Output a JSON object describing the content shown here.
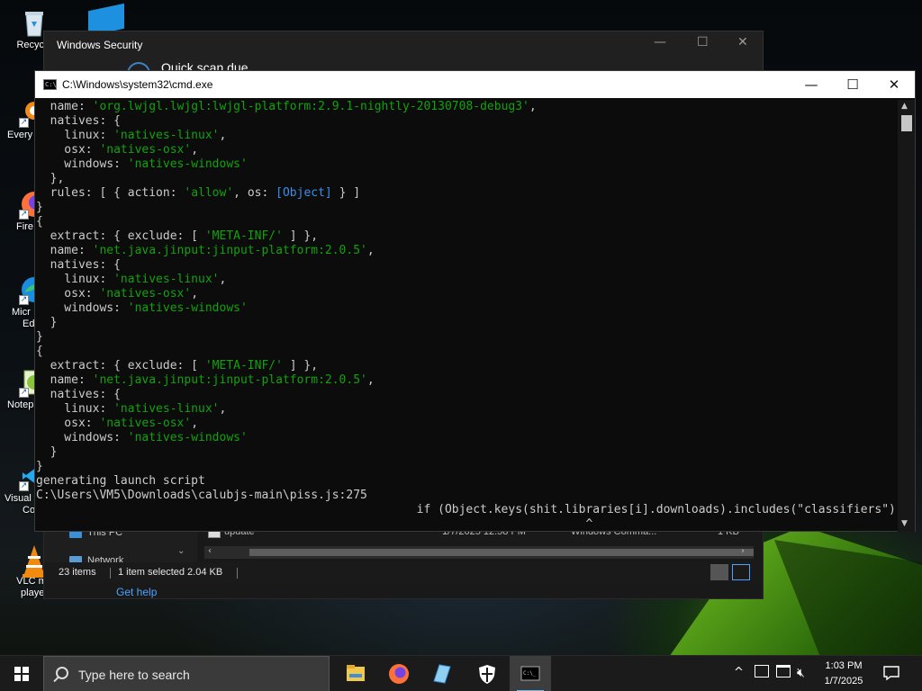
{
  "desktop": {
    "icons": [
      {
        "label": "Recycle",
        "icon": "recycle-bin-icon"
      },
      {
        "label": "Every",
        "icon": "everything-search-icon"
      },
      {
        "label": "Fire",
        "icon": "firefox-icon"
      },
      {
        "label": "Micr",
        "label2": "Ed",
        "icon": "edge-icon"
      },
      {
        "label": "Notep",
        "icon": "notepadpp-icon"
      },
      {
        "label": "Visual",
        "label2": "Co",
        "icon": "vscode-icon"
      },
      {
        "label": "VLC me",
        "label2": "player",
        "icon": "vlc-icon"
      }
    ]
  },
  "windows_security": {
    "title": "Windows Security",
    "heading": "Quick scan due"
  },
  "explorer": {
    "nav_items": [
      "This PC",
      "Network"
    ],
    "file_row": {
      "name": "update",
      "date": "1/7/2025 12:58 PM",
      "type": "Windows Comma...",
      "size": "1 KB"
    },
    "status": {
      "items": "23 items",
      "selected": "1 item selected  2.04 KB"
    },
    "get_help": "Get help"
  },
  "cmd": {
    "title": "C:\\Windows\\system32\\cmd.exe",
    "icon_text": "C:\\_",
    "lines": [
      [
        {
          "t": "  name: "
        },
        {
          "t": "'org.lwjgl.lwjgl:lwjgl-platform:2.9.1-nightly-20130708-debug3'",
          "c": "s"
        },
        {
          "t": ","
        }
      ],
      [
        {
          "t": "  natives: {"
        }
      ],
      [
        {
          "t": "    linux: "
        },
        {
          "t": "'natives-linux'",
          "c": "s"
        },
        {
          "t": ","
        }
      ],
      [
        {
          "t": "    osx: "
        },
        {
          "t": "'natives-osx'",
          "c": "s"
        },
        {
          "t": ","
        }
      ],
      [
        {
          "t": "    windows: "
        },
        {
          "t": "'natives-windows'",
          "c": "s"
        }
      ],
      [
        {
          "t": "  },"
        }
      ],
      [
        {
          "t": "  rules: [ { action: "
        },
        {
          "t": "'allow'",
          "c": "s"
        },
        {
          "t": ", os: "
        },
        {
          "t": "[Object]",
          "c": "o"
        },
        {
          "t": " } ]"
        }
      ],
      [
        {
          "t": "}"
        }
      ],
      [
        {
          "t": "{"
        }
      ],
      [
        {
          "t": "  extract: { exclude: [ "
        },
        {
          "t": "'META-INF/'",
          "c": "s"
        },
        {
          "t": " ] },"
        }
      ],
      [
        {
          "t": "  name: "
        },
        {
          "t": "'net.java.jinput:jinput-platform:2.0.5'",
          "c": "s"
        },
        {
          "t": ","
        }
      ],
      [
        {
          "t": "  natives: {"
        }
      ],
      [
        {
          "t": "    linux: "
        },
        {
          "t": "'natives-linux'",
          "c": "s"
        },
        {
          "t": ","
        }
      ],
      [
        {
          "t": "    osx: "
        },
        {
          "t": "'natives-osx'",
          "c": "s"
        },
        {
          "t": ","
        }
      ],
      [
        {
          "t": "    windows: "
        },
        {
          "t": "'natives-windows'",
          "c": "s"
        }
      ],
      [
        {
          "t": "  }"
        }
      ],
      [
        {
          "t": "}"
        }
      ],
      [
        {
          "t": "{"
        }
      ],
      [
        {
          "t": "  extract: { exclude: [ "
        },
        {
          "t": "'META-INF/'",
          "c": "s"
        },
        {
          "t": " ] },"
        }
      ],
      [
        {
          "t": "  name: "
        },
        {
          "t": "'net.java.jinput:jinput-platform:2.0.5'",
          "c": "s"
        },
        {
          "t": ","
        }
      ],
      [
        {
          "t": "  natives: {"
        }
      ],
      [
        {
          "t": "    linux: "
        },
        {
          "t": "'natives-linux'",
          "c": "s"
        },
        {
          "t": ","
        }
      ],
      [
        {
          "t": "    osx: "
        },
        {
          "t": "'natives-osx'",
          "c": "s"
        },
        {
          "t": ","
        }
      ],
      [
        {
          "t": "    windows: "
        },
        {
          "t": "'natives-windows'",
          "c": "s"
        }
      ],
      [
        {
          "t": "  }"
        }
      ],
      [
        {
          "t": "}"
        }
      ],
      [
        {
          "t": "generating launch script"
        }
      ],
      [
        {
          "t": "C:\\Users\\VM5\\Downloads\\calubjs-main\\piss.js:275"
        }
      ],
      [
        {
          "t": "                                                      if (Object.keys(shit.libraries[i].downloads).includes(\"classifiers\")){"
        }
      ],
      [
        {
          "t": "                                                                              ^"
        }
      ]
    ]
  },
  "taskbar": {
    "search_placeholder": "Type here to search",
    "apps": [
      {
        "name": "file-explorer-icon",
        "active": false
      },
      {
        "name": "firefox-icon",
        "active": false
      },
      {
        "name": "notepad-icon",
        "active": false
      },
      {
        "name": "windows-security-icon",
        "active": false
      },
      {
        "name": "cmd-icon",
        "active": true
      }
    ],
    "time": "1:03 PM",
    "date": "1/7/2025"
  },
  "colors": {
    "string": "#13a10e",
    "object": "#3b8eea",
    "console_text": "#cccccc",
    "taskbar": "#1b1b1b",
    "accent": "#76b9ed"
  }
}
